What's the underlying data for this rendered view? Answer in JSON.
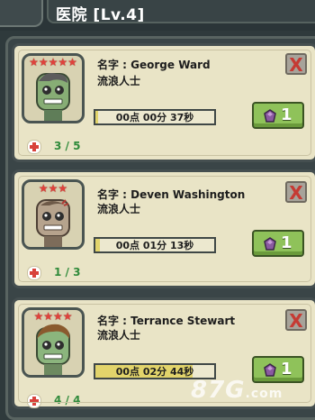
{
  "header": {
    "title": "医院 [Lv.4]"
  },
  "patients": [
    {
      "stars": "★★★★★",
      "name": "名字 : George Ward",
      "role": "流浪人士",
      "timer": "00点 00分 37秒",
      "timer_progress": 0.02,
      "speedup_count": "1",
      "hp": "3 / 5",
      "close_label": "X",
      "skin": "#87ad75",
      "hair": "#5c5c5c"
    },
    {
      "stars": "★★★",
      "name": "名字 : Deven Washington",
      "role": "流浪人士",
      "timer": "00点 01分 13秒",
      "timer_progress": 0.04,
      "speedup_count": "1",
      "hp": "1 / 3",
      "close_label": "X",
      "skin": "#b6a38d",
      "hair": "#6e5a49"
    },
    {
      "stars": "★★★★",
      "name": "名字 : Terrance  Stewart",
      "role": "流浪人士",
      "timer": "00点 02分 44秒",
      "timer_progress": 0.82,
      "speedup_count": "1",
      "hp": "4 / 4",
      "close_label": "X",
      "skin": "#8bb57d",
      "hair": "#8a5a2e"
    }
  ],
  "icons": {
    "close": "close-icon",
    "gem": "gem-icon",
    "health": "health-cross-icon"
  },
  "watermark": {
    "text": "87G",
    "suffix": ".com"
  }
}
